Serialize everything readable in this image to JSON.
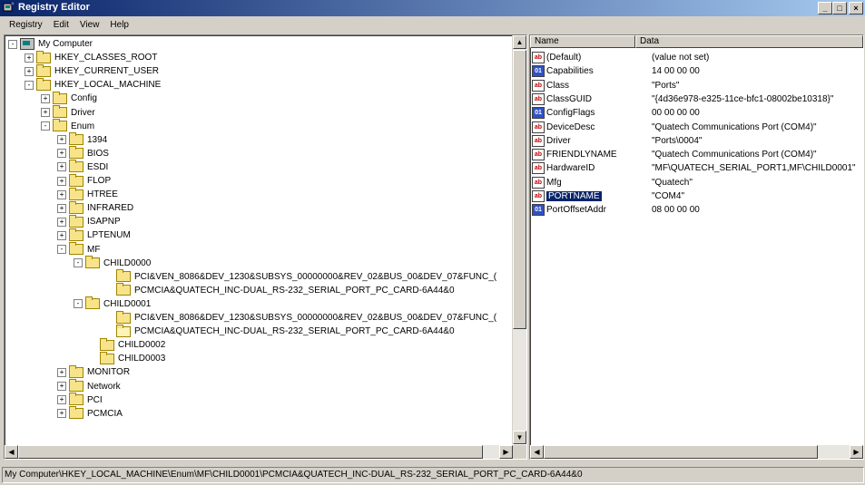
{
  "window": {
    "title": "Registry Editor",
    "buttons": {
      "minimize": "_",
      "maximize": "□",
      "close": "×"
    }
  },
  "menu": [
    "Registry",
    "Edit",
    "View",
    "Help"
  ],
  "tree": [
    {
      "label": "My Computer",
      "expander": "-",
      "icon": "computer-icon"
    },
    {
      "label": "HKEY_CLASSES_ROOT",
      "expander": "+",
      "icon": "folder-icon"
    },
    {
      "label": "HKEY_CURRENT_USER",
      "expander": "+",
      "icon": "folder-icon"
    },
    {
      "label": "HKEY_LOCAL_MACHINE",
      "expander": "-",
      "icon": "folder-icon"
    },
    {
      "label": "Config",
      "expander": "+",
      "icon": "folder-icon"
    },
    {
      "label": "Driver",
      "expander": "+",
      "icon": "folder-icon"
    },
    {
      "label": "Enum",
      "expander": "-",
      "icon": "folder-icon"
    },
    {
      "label": "1394",
      "expander": "+",
      "icon": "folder-icon"
    },
    {
      "label": "BIOS",
      "expander": "+",
      "icon": "folder-icon"
    },
    {
      "label": "ESDI",
      "expander": "+",
      "icon": "folder-icon"
    },
    {
      "label": "FLOP",
      "expander": "+",
      "icon": "folder-icon"
    },
    {
      "label": "HTREE",
      "expander": "+",
      "icon": "folder-icon"
    },
    {
      "label": "INFRARED",
      "expander": "+",
      "icon": "folder-icon"
    },
    {
      "label": "ISAPNP",
      "expander": "+",
      "icon": "folder-icon"
    },
    {
      "label": "LPTENUM",
      "expander": "+",
      "icon": "folder-icon"
    },
    {
      "label": "MF",
      "expander": "-",
      "icon": "folder-icon"
    },
    {
      "label": "CHILD0000",
      "expander": "-",
      "icon": "folder-icon"
    },
    {
      "label": "PCI&VEN_8086&DEV_1230&SUBSYS_00000000&REV_02&BUS_00&DEV_07&FUNC_(",
      "expander": "",
      "icon": "folder-icon"
    },
    {
      "label": "PCMCIA&QUATECH_INC-DUAL_RS-232_SERIAL_PORT_PC_CARD-6A44&0",
      "expander": "",
      "icon": "folder-icon"
    },
    {
      "label": "CHILD0001",
      "expander": "-",
      "icon": "folder-icon"
    },
    {
      "label": "PCI&VEN_8086&DEV_1230&SUBSYS_00000000&REV_02&BUS_00&DEV_07&FUNC_(",
      "expander": "",
      "icon": "folder-icon"
    },
    {
      "label": "PCMCIA&QUATECH_INC-DUAL_RS-232_SERIAL_PORT_PC_CARD-6A44&0",
      "expander": "",
      "icon": "folder-open-icon"
    },
    {
      "label": "CHILD0002",
      "expander": "",
      "icon": "folder-icon"
    },
    {
      "label": "CHILD0003",
      "expander": "",
      "icon": "folder-icon"
    },
    {
      "label": "MONITOR",
      "expander": "+",
      "icon": "folder-icon"
    },
    {
      "label": "Network",
      "expander": "+",
      "icon": "folder-icon"
    },
    {
      "label": "PCI",
      "expander": "+",
      "icon": "folder-icon"
    },
    {
      "label": "PCMCIA",
      "expander": "+",
      "icon": "folder-icon"
    }
  ],
  "list": {
    "headers": {
      "name": "Name",
      "data": "Data"
    },
    "rows": [
      {
        "name": "(Default)",
        "data": "(value not set)",
        "type": "string"
      },
      {
        "name": "Capabilities",
        "data": "14 00 00 00",
        "type": "binary"
      },
      {
        "name": "Class",
        "data": "\"Ports\"",
        "type": "string"
      },
      {
        "name": "ClassGUID",
        "data": "\"{4d36e978-e325-11ce-bfc1-08002be10318}\"",
        "type": "string"
      },
      {
        "name": "ConfigFlags",
        "data": "00 00 00 00",
        "type": "binary"
      },
      {
        "name": "DeviceDesc",
        "data": "\"Quatech Communications Port (COM4)\"",
        "type": "string"
      },
      {
        "name": "Driver",
        "data": "\"Ports\\0004\"",
        "type": "string"
      },
      {
        "name": "FRIENDLYNAME",
        "data": "\"Quatech Communications Port (COM4)\"",
        "type": "string"
      },
      {
        "name": "HardwareID",
        "data": "\"MF\\QUATECH_SERIAL_PORT1,MF\\CHILD0001\"",
        "type": "string"
      },
      {
        "name": "Mfg",
        "data": "\"Quatech\"",
        "type": "string"
      },
      {
        "name": "PORTNAME",
        "data": "\"COM4\"",
        "type": "string",
        "selected": true
      },
      {
        "name": "PortOffsetAddr",
        "data": "08 00 00 00",
        "type": "binary"
      }
    ]
  },
  "status": {
    "path": "My Computer\\HKEY_LOCAL_MACHINE\\Enum\\MF\\CHILD0001\\PCMCIA&QUATECH_INC-DUAL_RS-232_SERIAL_PORT_PC_CARD-6A44&0"
  },
  "colors": {
    "title_bar": "#0a246a",
    "selection": "#0a246a",
    "window_face": "#d4d0c8"
  }
}
